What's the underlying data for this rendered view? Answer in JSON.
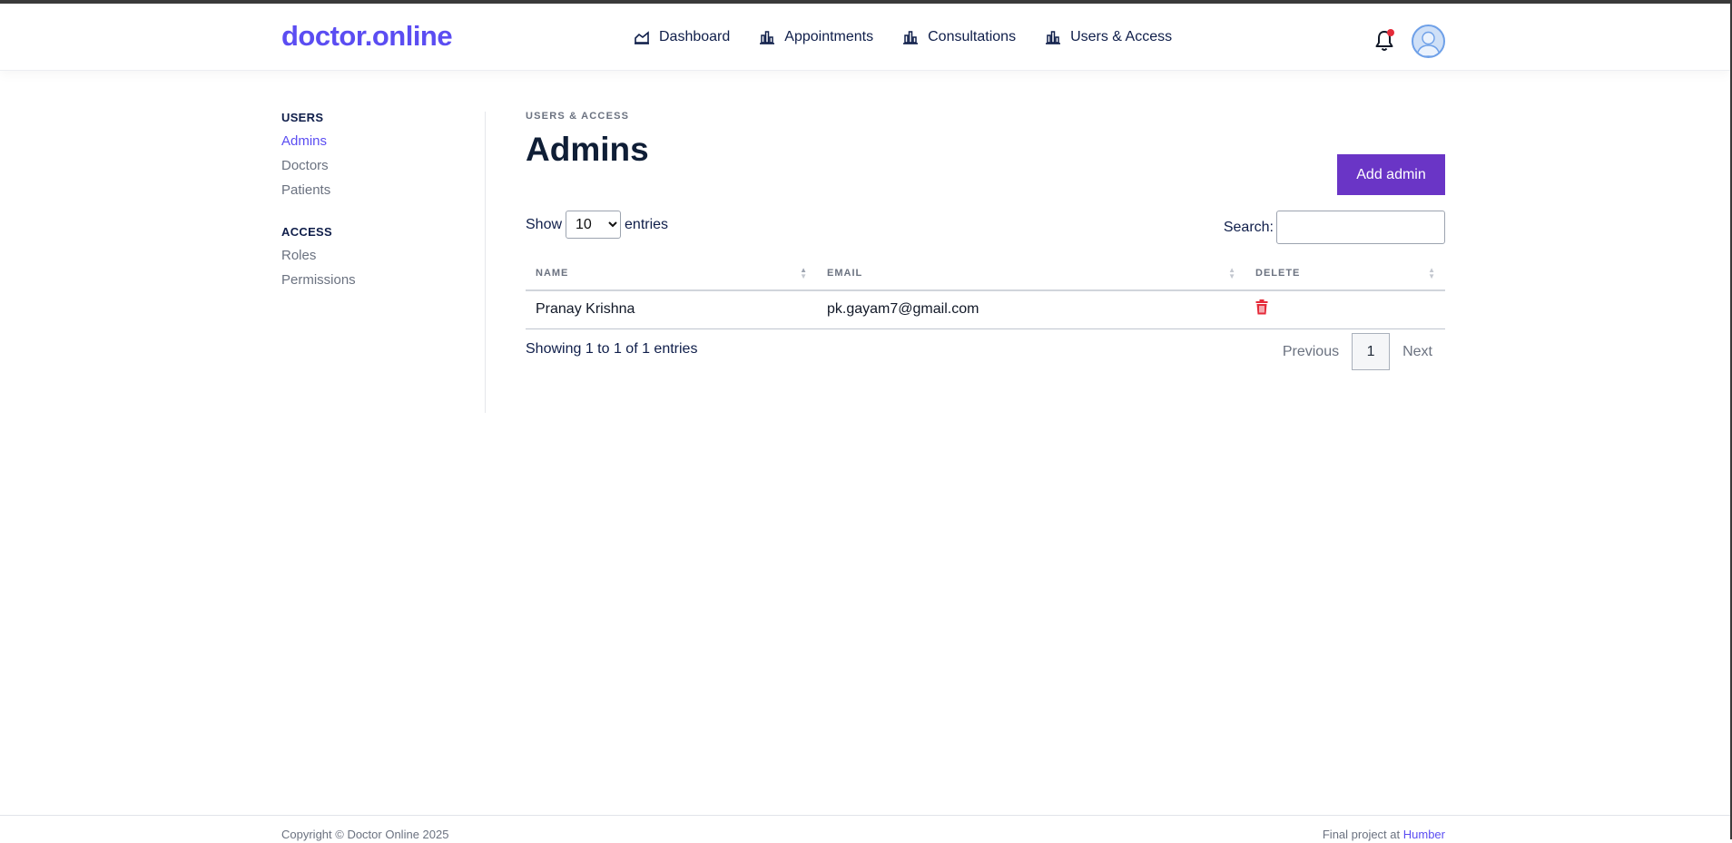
{
  "header": {
    "logo": "doctor.online",
    "nav": [
      {
        "label": "Dashboard",
        "icon": "area-chart-icon"
      },
      {
        "label": "Appointments",
        "icon": "bar-chart-icon"
      },
      {
        "label": "Consultations",
        "icon": "bar-chart-icon"
      },
      {
        "label": "Users & Access",
        "icon": "bar-chart-icon"
      }
    ],
    "notification_icon": "bell-icon",
    "avatar_icon": "user-avatar-icon"
  },
  "sidebar": {
    "groups": [
      {
        "heading": "USERS",
        "items": [
          "Admins",
          "Doctors",
          "Patients"
        ]
      },
      {
        "heading": "ACCESS",
        "items": [
          "Roles",
          "Permissions"
        ]
      }
    ],
    "active_item": "Admins"
  },
  "main": {
    "breadcrumb": "USERS & ACCESS",
    "title": "Admins",
    "add_button": "Add admin",
    "show_label": "Show",
    "entries_label": "entries",
    "page_size": "10",
    "page_size_options": [
      "10"
    ],
    "search_label": "Search:",
    "search_value": "",
    "columns": [
      "NAME",
      "EMAIL",
      "DELETE"
    ],
    "rows": [
      {
        "name": "Pranay Krishna",
        "email": "pk.gayam7@gmail.com",
        "delete_icon": "trash-icon"
      }
    ],
    "info": "Showing 1 to 1 of 1 entries",
    "pagination": {
      "previous": "Previous",
      "page": "1",
      "next": "Next"
    }
  },
  "footer": {
    "copyright": "Copyright © Doctor Online 2025",
    "credit_prefix": "Final project at",
    "credit_link": "Humber"
  },
  "colors": {
    "brand": "#5b4df2",
    "button": "#6a35c6",
    "danger": "#e52b3a",
    "nav_text": "#0f1e4a"
  }
}
